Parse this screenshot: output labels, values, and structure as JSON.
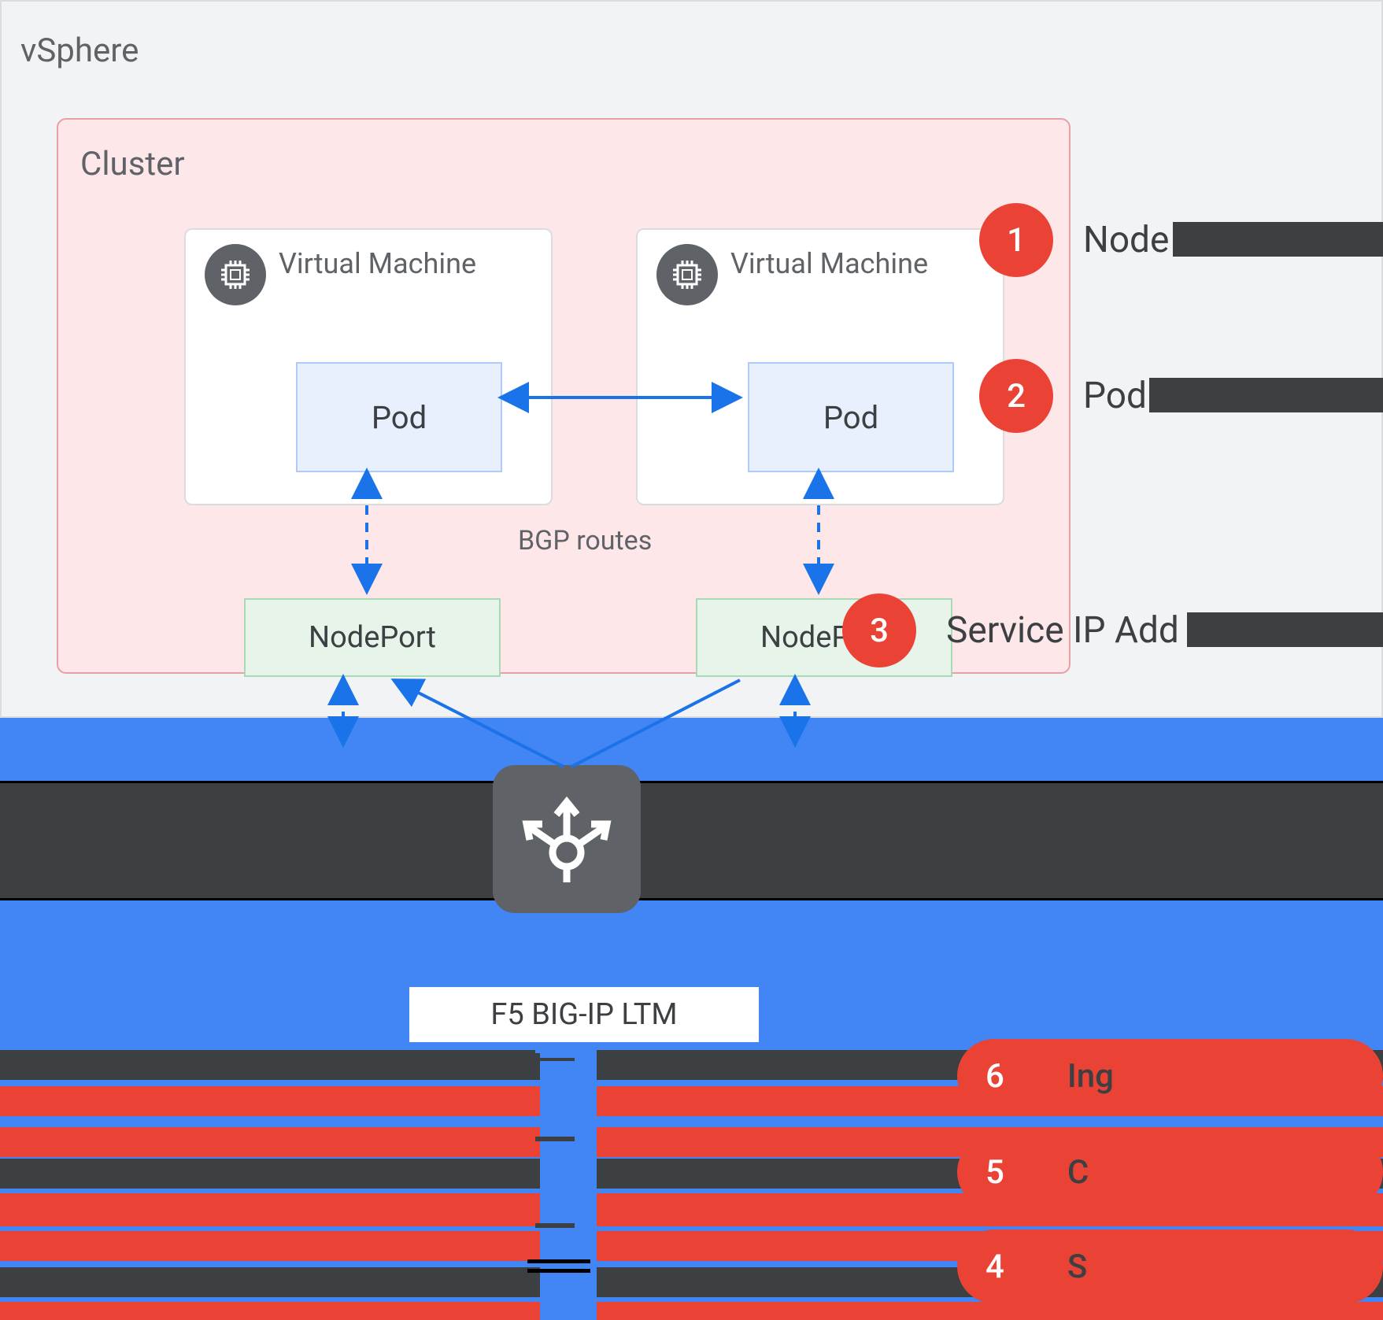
{
  "vsphere": {
    "title": "vSphere"
  },
  "cluster": {
    "title": "Cluster",
    "vms": [
      {
        "label": "Virtual Machine",
        "pod_label": "Pod",
        "nodeport_label": "NodePort"
      },
      {
        "label": "Virtual Machine",
        "pod_label": "Pod",
        "nodeport_label": "NodePort"
      }
    ],
    "bgp_label": "BGP routes"
  },
  "loadbalancer": {
    "label": "F5 BIG-IP LTM"
  },
  "annotations": {
    "a1": {
      "num": "1",
      "label": "Node"
    },
    "a2": {
      "num": "2",
      "label": "Pod"
    },
    "a3": {
      "num": "3",
      "label": "Service IP Add"
    },
    "a4": {
      "num": "4",
      "label": "S"
    },
    "a5": {
      "num": "5",
      "label": "C"
    },
    "a6": {
      "num": "6",
      "label": "Ing"
    }
  }
}
